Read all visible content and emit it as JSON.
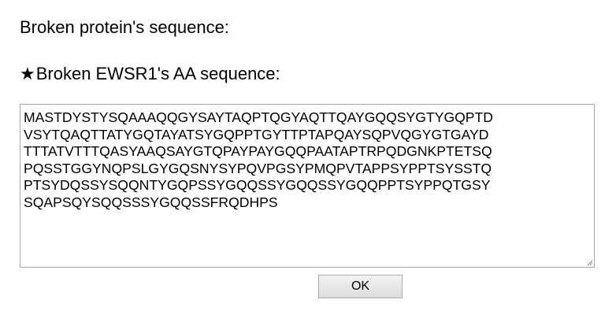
{
  "dialog": {
    "title": "Broken protein's sequence:",
    "star_glyph": "★",
    "subtitle": "Broken EWSR1's AA sequence:",
    "sequence_lines": [
      "MASTDYSTYSQAAAQQGYSAYTAQPTQGYAQTTQAYGQQSYGTYGQPTD",
      "VSYTQAQTTATYGQTAYATSYGQPPTGYTTPTAPQAYSQPVQGYGTGAYD",
      "TTTATVTTTQASYAAQSAYGTQPAYPAYGQQPAATAPTRPQDGNKPTETSQ",
      "PQSSTGGYNQPSLGYGQSNYSYPQVPGSYPMQPVTAPPSYPPTSYSSTQ",
      "PTSYDQSSYSQQNTYGQPSSYGQQSSYGQQSSYGQQPPTSYPPQTGSY",
      "SQAPSQYSQQSSSYGQQSSFRQDHPS"
    ],
    "ok_label": "OK"
  }
}
